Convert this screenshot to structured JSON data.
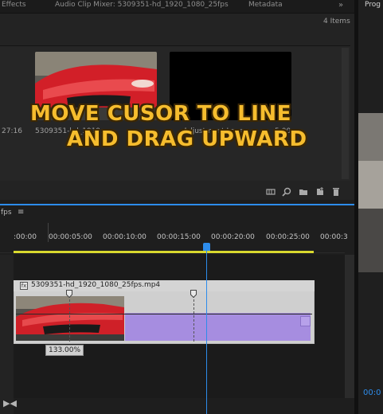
{
  "project_panel": {
    "tabs": [
      "Effects",
      "Audio Clip Mixer: 5309351-hd_1920_1080_25fps",
      "Metadata"
    ],
    "tab_menu": "»",
    "items_count": "4 Items",
    "left_duration": "27:16",
    "items": [
      {
        "name": "5309351-hd_1919...",
        "thumb": "car"
      },
      {
        "name": "Adjustment Layer",
        "duration": "5:00",
        "thumb": "black"
      }
    ],
    "tools": [
      "freeform-view-icon",
      "find-icon",
      "new-bin-icon",
      "new-item-icon",
      "trash-icon"
    ]
  },
  "program_monitor": {
    "tab": "Prog",
    "timecode": "00:0"
  },
  "timeline": {
    "sequence_label": "fps",
    "menu": "≡",
    "ruler_ticks": [
      ":00:00",
      "00:00:05:00",
      "00:00:10:00",
      "00:00:15:00",
      "00:00:20:00",
      "00:00:25:00",
      "00:00:3"
    ],
    "clip": {
      "badge": "fx",
      "name": "5309351-hd_1920_1080_25fps.mp4",
      "keyframe_tooltip": "133.00%"
    },
    "bottom_icon": "▶◀"
  },
  "overlay_caption": {
    "line1": "Move cusor to line",
    "line2": "and drag upward"
  },
  "colors": {
    "accent_blue": "#2d8ceb",
    "workarea_yellow": "#d9d92e",
    "clip_purple": "#a68de0",
    "caption_fill": "#f6bd2e"
  }
}
